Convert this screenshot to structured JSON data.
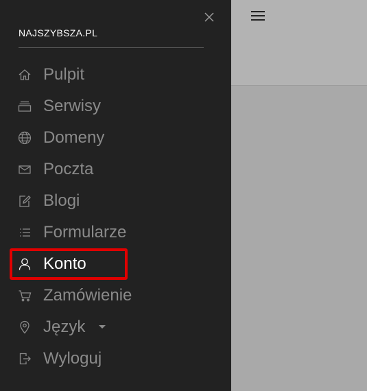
{
  "drawer": {
    "brand": "NAJSZYBSZA.PL",
    "items": [
      {
        "label": "Pulpit",
        "icon": "home-icon"
      },
      {
        "label": "Serwisy",
        "icon": "layers-icon"
      },
      {
        "label": "Domeny",
        "icon": "globe-icon"
      },
      {
        "label": "Poczta",
        "icon": "mail-icon"
      },
      {
        "label": "Blogi",
        "icon": "edit-icon"
      },
      {
        "label": "Formularze",
        "icon": "list-icon"
      },
      {
        "label": "Konto",
        "icon": "user-icon",
        "active": true
      },
      {
        "label": "Zamówienie",
        "icon": "cart-icon"
      },
      {
        "label": "Język",
        "icon": "location-pin-icon",
        "has_dropdown": true
      },
      {
        "label": "Wyloguj",
        "icon": "logout-icon"
      }
    ]
  },
  "colors": {
    "drawer_bg": "#222222",
    "item_text": "#8a8a8a",
    "active_text": "#ffffff",
    "highlight": "#e00000",
    "overlay": "#a8a8a8"
  }
}
